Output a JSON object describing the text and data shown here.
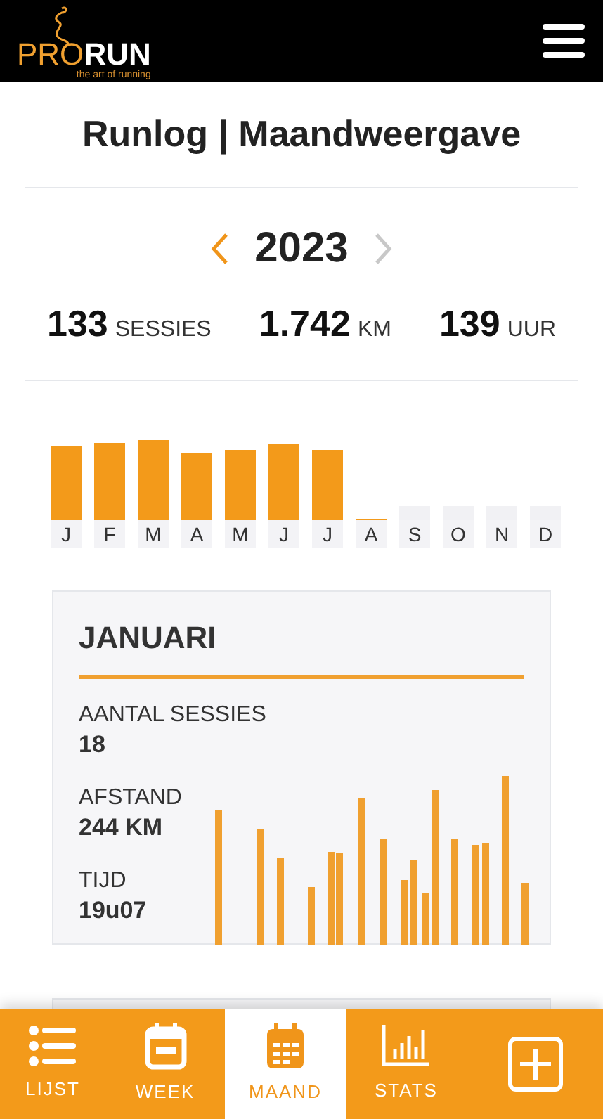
{
  "header": {
    "logo_prefix": "PRO",
    "logo_suffix": "RUN",
    "tagline": "the art of running"
  },
  "title": "Runlog | Maandweergave",
  "year_nav": {
    "year": "2023",
    "prev_disabled": false,
    "next_disabled": true
  },
  "totals": [
    {
      "value": "133",
      "unit": "SESSIES"
    },
    {
      "value": "1.742",
      "unit": "KM"
    },
    {
      "value": "139",
      "unit": "UUR"
    }
  ],
  "months": [
    {
      "label": "J",
      "has_data": true
    },
    {
      "label": "F",
      "has_data": true
    },
    {
      "label": "M",
      "has_data": true
    },
    {
      "label": "A",
      "has_data": true
    },
    {
      "label": "M",
      "has_data": true
    },
    {
      "label": "J",
      "has_data": true
    },
    {
      "label": "J",
      "has_data": true
    },
    {
      "label": "A",
      "has_data": true
    },
    {
      "label": "S",
      "has_data": false
    },
    {
      "label": "O",
      "has_data": false
    },
    {
      "label": "N",
      "has_data": false
    },
    {
      "label": "D",
      "has_data": false
    }
  ],
  "month_card": {
    "title": "JANUARI",
    "stats": [
      {
        "label": "AANTAL SESSIES",
        "value": "18"
      },
      {
        "label": "AFSTAND",
        "value": "244 KM"
      },
      {
        "label": "TIJD",
        "value": "19u07"
      }
    ]
  },
  "bottom_nav": [
    {
      "label": "LIJST",
      "kind": "list",
      "selected": false
    },
    {
      "label": "WEEK",
      "kind": "week",
      "selected": false
    },
    {
      "label": "MAAND",
      "kind": "month",
      "selected": true
    },
    {
      "label": "STATS",
      "kind": "stats",
      "selected": false
    },
    {
      "kind": "add",
      "selected": false
    }
  ]
}
